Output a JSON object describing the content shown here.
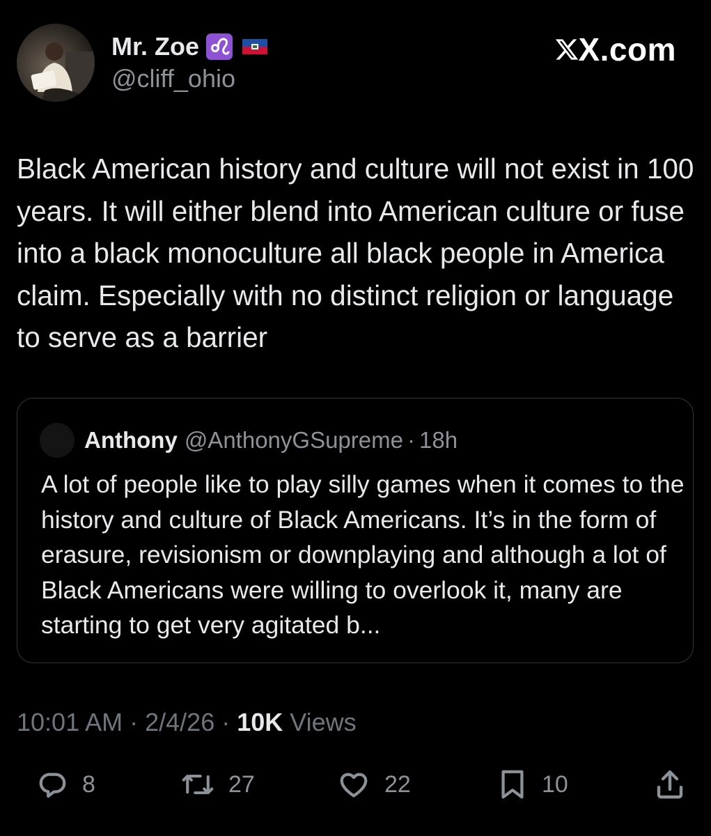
{
  "author": {
    "display_name": "Mr. Zoe",
    "handle": "@cliff_ohio",
    "badges": [
      "leo-zodiac-icon",
      "haiti-flag-icon"
    ]
  },
  "brand": {
    "label": "X.com"
  },
  "tweet": {
    "text": "Black American history and culture will not exist in 100 years. It will either blend into American culture or fuse into a black monoculture all black people in America claim. Especially with no distinct religion or language to serve as a barrier"
  },
  "quote": {
    "name": "Anthony",
    "handle": "@AnthonyGSupreme",
    "time": "18h",
    "text": "A lot of people like to play silly games when it comes to the history and culture of Black Americans. It’s in the form of erasure, revisionism or downplaying and although a lot of Black Americans were willing to overlook it, many are starting to get very agitated b..."
  },
  "meta": {
    "time": "10:01 AM",
    "date": "2/4/26",
    "views_count": "10K",
    "views_label": "Views"
  },
  "actions": {
    "replies": "8",
    "reposts": "27",
    "likes": "22",
    "bookmarks": "10"
  },
  "colors": {
    "background": "#000000",
    "text": "#e7e9ea",
    "muted": "#8b9298",
    "border": "#333639",
    "zodiac_badge": "#8e52d6"
  }
}
